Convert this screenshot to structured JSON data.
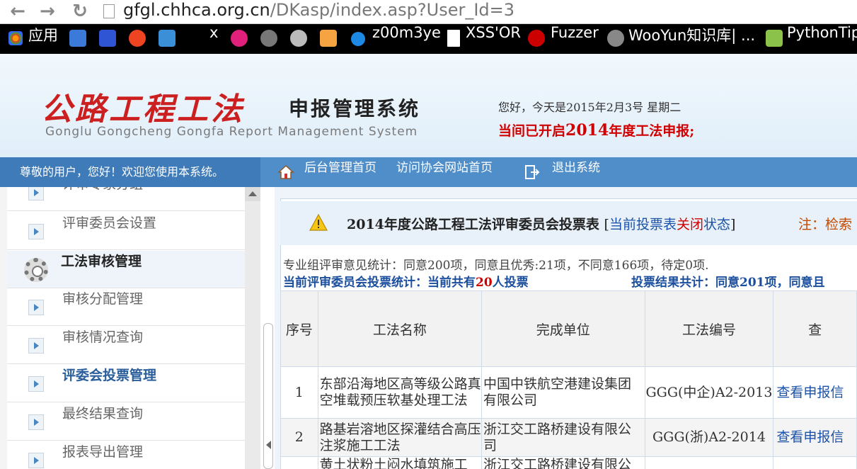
{
  "browser": {
    "url_host": "gfgl.chhca.org.cn",
    "url_path": "/DKasp/index.asp?User_Id=3",
    "bookmarks": {
      "apps": "应用",
      "x": "x",
      "z00m3ye": "z00m3ye",
      "xss": "XSS'OR",
      "fuzzer": "Fuzzer",
      "wooyun": "WooYun知识库| ...",
      "pythontip": "PythonTip"
    }
  },
  "header": {
    "logo_cn": "公路工程工法",
    "logo_sub": "申报管理系统",
    "logo_en": "Gonglu Gongcheng Gongfa Report Management System",
    "greeting_pre": "您好，今天是",
    "greeting_date": "2015",
    "greeting_y": "年",
    "greeting_m": "2",
    "greeting_m_s": "月",
    "greeting_d": "3",
    "greeting_post": "号 星期二",
    "notice_pre": "当间已开启",
    "notice_year": "2014",
    "notice_post": "年度工法申报;"
  },
  "nav": {
    "welcome": "尊敬的用户，您好！欢迎您使用本系统。",
    "home": "后台管理首页",
    "visit": "访问协会网站首页",
    "logout": "退出系统"
  },
  "sidebar": {
    "items": [
      {
        "label": "评审专家分组"
      },
      {
        "label": "评审委员会设置"
      },
      {
        "label": "工法审核管理"
      },
      {
        "label": "审核分配管理"
      },
      {
        "label": "审核情况查询"
      },
      {
        "label": "评委会投票管理"
      },
      {
        "label": "最终结果查询"
      },
      {
        "label": "报表导出管理"
      }
    ]
  },
  "main": {
    "title": "2014年度公路工程工法评审委员会投票表",
    "bracket_open": "[",
    "status_a": "当前投票表",
    "status_b": "关闭",
    "status_c": "状态",
    "bracket_close": "]",
    "note": "注：检索",
    "stats_line": "专业组评审意见统计：同意200项，同意且优秀:21项，不同意166项，待定0项.",
    "vote_pre": "当前评审委员会投票统计：当前共有",
    "vote_count": "20",
    "vote_post": "人投票",
    "result": "投票结果共计：同意201项，同意且"
  },
  "table": {
    "headers": [
      "序号",
      "工法名称",
      "完成单位",
      "工法编号",
      "查"
    ],
    "rows": [
      {
        "no": "1",
        "name": "东部沿海地区高等级公路真空堆载预压软基处理工法",
        "unit": "中国中铁航空港建设集团有限公司",
        "code": "GGG(中企)A2-2013",
        "action": "查看申报信"
      },
      {
        "no": "2",
        "name": "路基岩溶地区探灌结合高压注浆施工工法",
        "unit": "浙江交工路桥建设有限公司",
        "code": "GGG(浙)A2-2014",
        "action": "查看申报信"
      },
      {
        "no": "",
        "name": "黄土状粉土闷水填筑施工",
        "unit": "浙江交工路桥建设有限公",
        "code": "",
        "action": ""
      }
    ]
  },
  "colors": {
    "accent": "#4f8ec9",
    "logo_red": "#cc1f1f",
    "link_blue": "#1b52a8"
  }
}
